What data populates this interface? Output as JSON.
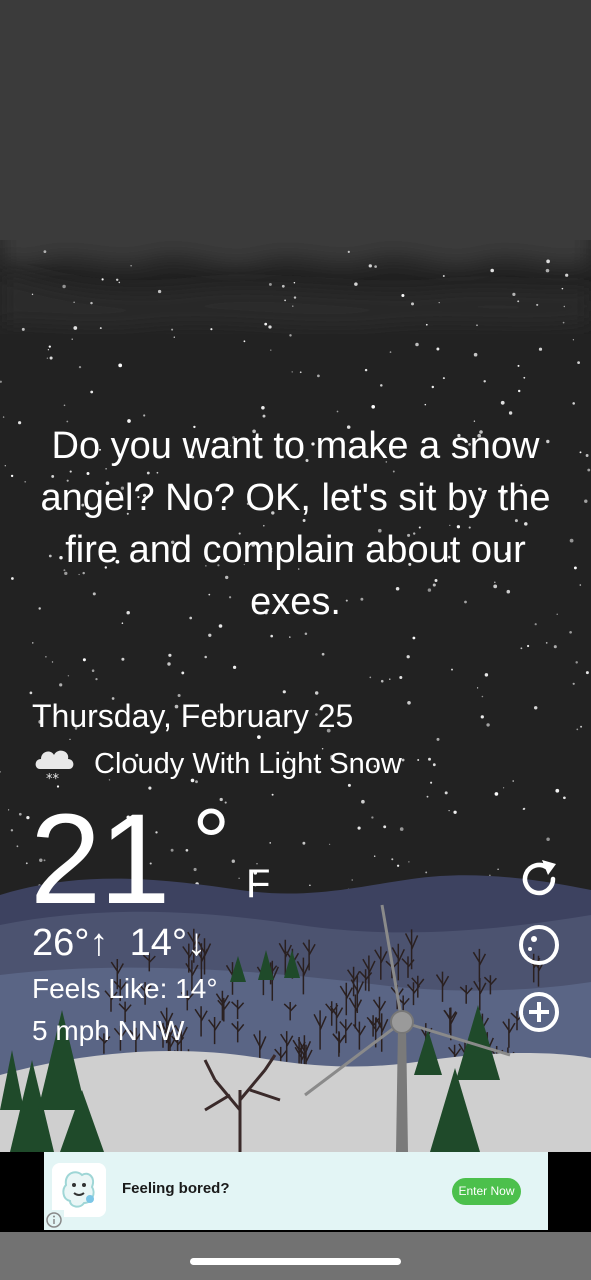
{
  "message": "Do you want to make a snow angel? No? OK, let's sit by the fire and complain about our exes.",
  "weather": {
    "date": "Thursday, February 25",
    "condition": "Cloudy With Light Snow",
    "condition_icon": "cloud-snow-icon",
    "temperature": "21",
    "degree_symbol": "°",
    "unit": "F",
    "high": "26°",
    "high_arrow": "↑",
    "low": "14°",
    "low_arrow": "↓",
    "feels_like": "Feels Like: 14°",
    "wind": "5 mph NNW"
  },
  "controls": [
    {
      "name": "refresh-icon"
    },
    {
      "name": "moon-icon"
    },
    {
      "name": "add-icon"
    }
  ],
  "ad": {
    "text": "Feeling bored?",
    "button": "Enter Now",
    "info_icon": "info-icon"
  },
  "colors": {
    "sky_top": "#3a3a3a",
    "sky": "#222222",
    "hill_far": "#3d4260",
    "hill_mid": "#5a6280",
    "ground": "#d0d0d0",
    "tree": "#1f4a2a",
    "ad_background": "#e3f5f5",
    "ad_button": "#4cc04c"
  }
}
